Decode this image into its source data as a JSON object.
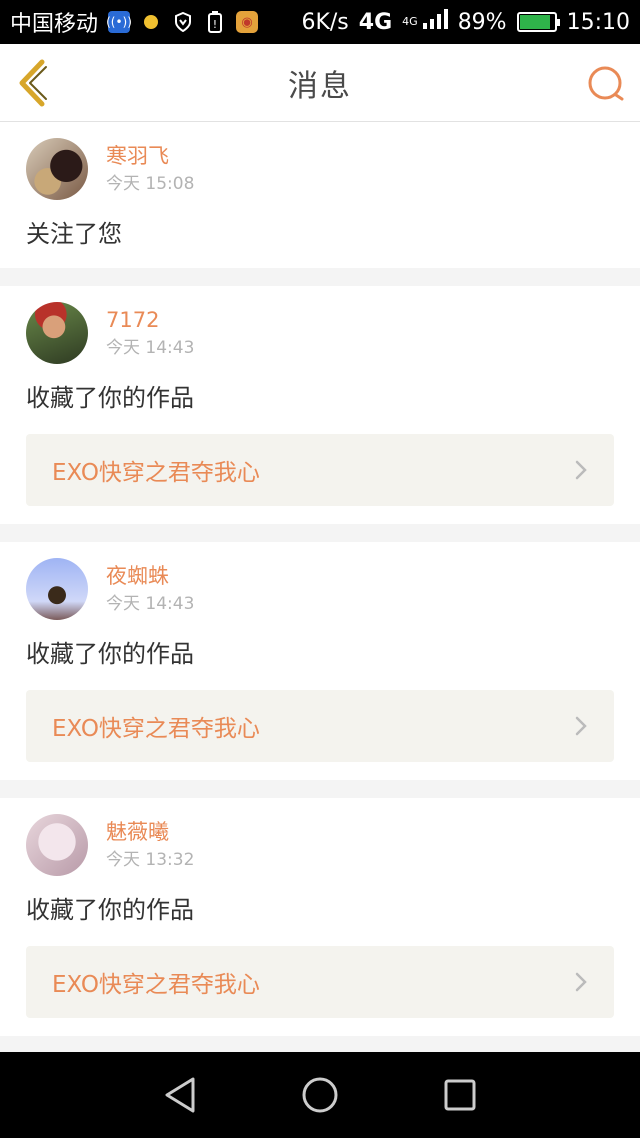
{
  "status_bar": {
    "carrier": "中国移动",
    "speed": "6K/s",
    "network": "4G",
    "network_small": "4G",
    "battery_percent": "89%",
    "battery_level": 0.89,
    "time": "15:10",
    "icons": [
      "wifi-hotspot-icon",
      "notification-dot-icon",
      "shield-icon",
      "battery-alert-icon",
      "weibo-icon"
    ]
  },
  "header": {
    "title": "消息",
    "back_icon": "back-chevron-icon",
    "search_icon": "search-icon",
    "accent_color": "#e98a56",
    "back_color": "#d7a62a"
  },
  "messages": [
    {
      "user": "寒羽飞",
      "time": "今天 15:08",
      "action": "关注了您",
      "work": ""
    },
    {
      "user": "7172",
      "time": "今天 14:43",
      "action": "收藏了你的作品",
      "work": "EXO快穿之君夺我心"
    },
    {
      "user": "夜蜘蛛",
      "time": "今天 14:43",
      "action": "收藏了你的作品",
      "work": "EXO快穿之君夺我心"
    },
    {
      "user": "魅薇曦",
      "time": "今天 13:32",
      "action": "收藏了你的作品",
      "work": "EXO快穿之君夺我心"
    }
  ],
  "nav_bar": {
    "icons": [
      "back-triangle-icon",
      "home-circle-icon",
      "recents-square-icon"
    ]
  }
}
